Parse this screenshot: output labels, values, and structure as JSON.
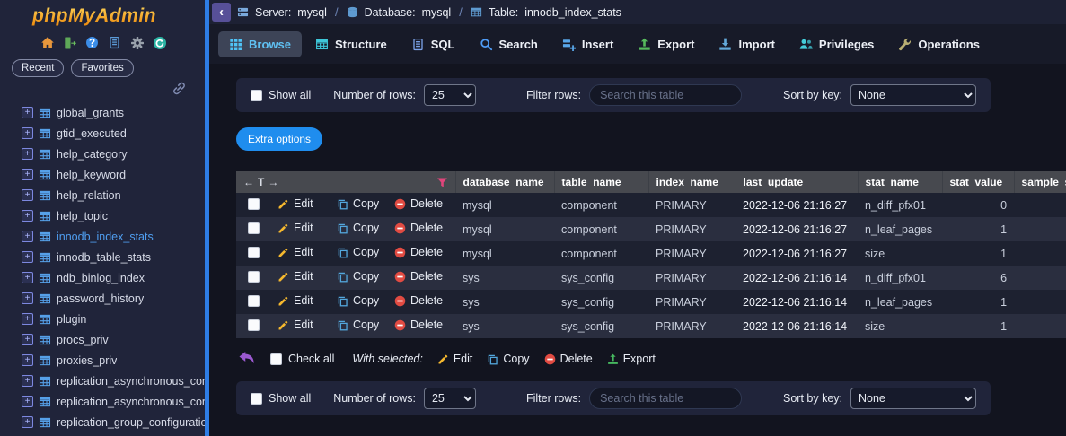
{
  "logo": "phpMyAdmin",
  "icons": {
    "collapse": "‹",
    "plus": "+",
    "arrow_left": "←",
    "transpose": "T",
    "arrow_right": "→"
  },
  "colors": {
    "accent_blue": "#1f8dee",
    "scrollbar_blue": "#2e7de5",
    "active_tab_cyan": "#5fc0f2",
    "selected_item_blue": "#4f9ef0",
    "edit_yellow": "#f5b82e",
    "copy_blue": "#53a7dd",
    "delete_red": "#e14b42",
    "export_green": "#46b85f",
    "funnel_pink": "#e0457b",
    "logo_orange": "#f09c2e",
    "undo_purple": "#9b59d0"
  },
  "sidebar": {
    "pills": [
      {
        "label": "Recent"
      },
      {
        "label": "Favorites"
      }
    ],
    "items": [
      {
        "label": "global_grants"
      },
      {
        "label": "gtid_executed"
      },
      {
        "label": "help_category"
      },
      {
        "label": "help_keyword"
      },
      {
        "label": "help_relation"
      },
      {
        "label": "help_topic"
      },
      {
        "label": "innodb_index_stats",
        "selected": true
      },
      {
        "label": "innodb_table_stats"
      },
      {
        "label": "ndb_binlog_index"
      },
      {
        "label": "password_history"
      },
      {
        "label": "plugin"
      },
      {
        "label": "procs_priv"
      },
      {
        "label": "proxies_priv"
      },
      {
        "label": "replication_asynchronous_connection_failover"
      },
      {
        "label": "replication_asynchronous_connection_failover_managed"
      },
      {
        "label": "replication_group_configuration_version"
      }
    ]
  },
  "breadcrumb": {
    "server_label": "Server:",
    "server_value": "mysql",
    "separator": "/",
    "database_label": "Database:",
    "database_value": "mysql",
    "table_label": "Table:",
    "table_value": "innodb_index_stats"
  },
  "tabs": [
    {
      "label": "Browse",
      "icon": "grid",
      "active": true
    },
    {
      "label": "Structure",
      "icon": "table"
    },
    {
      "label": "SQL",
      "icon": "sql-file"
    },
    {
      "label": "Search",
      "icon": "magnifier"
    },
    {
      "label": "Insert",
      "icon": "insert-rows"
    },
    {
      "label": "Export",
      "icon": "export-arrow"
    },
    {
      "label": "Import",
      "icon": "import-arrow"
    },
    {
      "label": "Privileges",
      "icon": "users"
    },
    {
      "label": "Operations",
      "icon": "wrench"
    }
  ],
  "controls": {
    "show_all": "Show all",
    "rows_label": "Number of rows:",
    "rows_value": "25",
    "filter_label": "Filter rows:",
    "filter_placeholder": "Search this table",
    "sort_label": "Sort by key:",
    "sort_value": "None"
  },
  "extra_options_label": "Extra options",
  "table": {
    "headers": [
      "database_name",
      "table_name",
      "index_name",
      "last_update",
      "stat_name",
      "stat_value",
      "sample_size"
    ],
    "actions": {
      "edit": "Edit",
      "copy": "Copy",
      "delete": "Delete"
    },
    "rows": [
      {
        "database_name": "mysql",
        "table_name": "component",
        "index_name": "PRIMARY",
        "last_update": "2022-12-06 21:16:27",
        "stat_name": "n_diff_pfx01",
        "stat_value": "0"
      },
      {
        "database_name": "mysql",
        "table_name": "component",
        "index_name": "PRIMARY",
        "last_update": "2022-12-06 21:16:27",
        "stat_name": "n_leaf_pages",
        "stat_value": "1"
      },
      {
        "database_name": "mysql",
        "table_name": "component",
        "index_name": "PRIMARY",
        "last_update": "2022-12-06 21:16:27",
        "stat_name": "size",
        "stat_value": "1"
      },
      {
        "database_name": "sys",
        "table_name": "sys_config",
        "index_name": "PRIMARY",
        "last_update": "2022-12-06 21:16:14",
        "stat_name": "n_diff_pfx01",
        "stat_value": "6"
      },
      {
        "database_name": "sys",
        "table_name": "sys_config",
        "index_name": "PRIMARY",
        "last_update": "2022-12-06 21:16:14",
        "stat_name": "n_leaf_pages",
        "stat_value": "1"
      },
      {
        "database_name": "sys",
        "table_name": "sys_config",
        "index_name": "PRIMARY",
        "last_update": "2022-12-06 21:16:14",
        "stat_name": "size",
        "stat_value": "1"
      }
    ]
  },
  "with_selected": {
    "check_all": "Check all",
    "label": "With selected:",
    "edit": "Edit",
    "copy": "Copy",
    "delete": "Delete",
    "export": "Export"
  }
}
